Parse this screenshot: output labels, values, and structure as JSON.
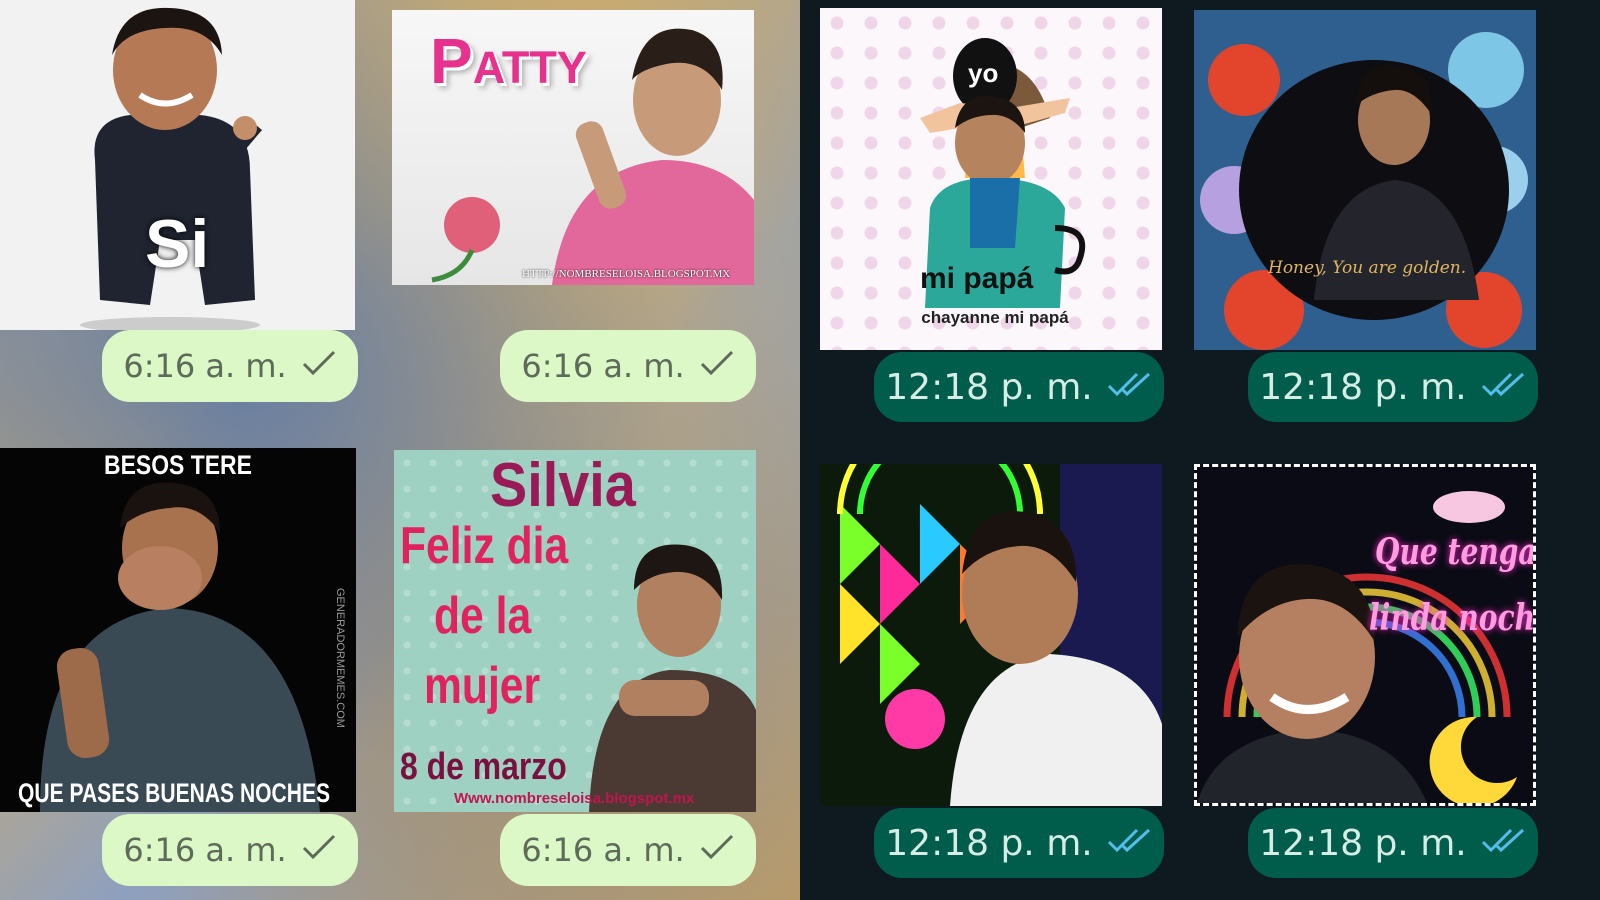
{
  "left_panel": {
    "stickers": [
      {
        "text": "Si"
      },
      {
        "text": "Patty",
        "url": "HTTP://NOMBRESELOISA.BLOGSPOT.MX"
      },
      {
        "top_text": "BESOS TERE",
        "bottom_text": "QUE PASES BUENAS NOCHES",
        "side_text": "GENERADORMEMES.COM"
      },
      {
        "title": "Silvia",
        "line1": "Feliz dia",
        "line2": "de la",
        "line3": "mujer",
        "date": "8 de marzo",
        "url": "Www.nombreseloisa.blogspot.mx"
      }
    ],
    "times": [
      "6:16 a. m.",
      "6:16 a. m.",
      "6:16 a. m.",
      "6:16 a. m."
    ],
    "status": "sent-single-check"
  },
  "right_panel": {
    "stickers": [
      {
        "top": "yo",
        "middle": "mi papá",
        "caption": "chayanne mi papá"
      },
      {
        "caption": "Honey, You are golden."
      },
      {
        "caption": ""
      },
      {
        "line1": "Que tengas",
        "line2": "linda noche"
      }
    ],
    "times": [
      "12:18 p. m.",
      "12:18 p. m.",
      "12:18 p. m.",
      "12:18 p. m."
    ],
    "status": "read-double-check"
  }
}
